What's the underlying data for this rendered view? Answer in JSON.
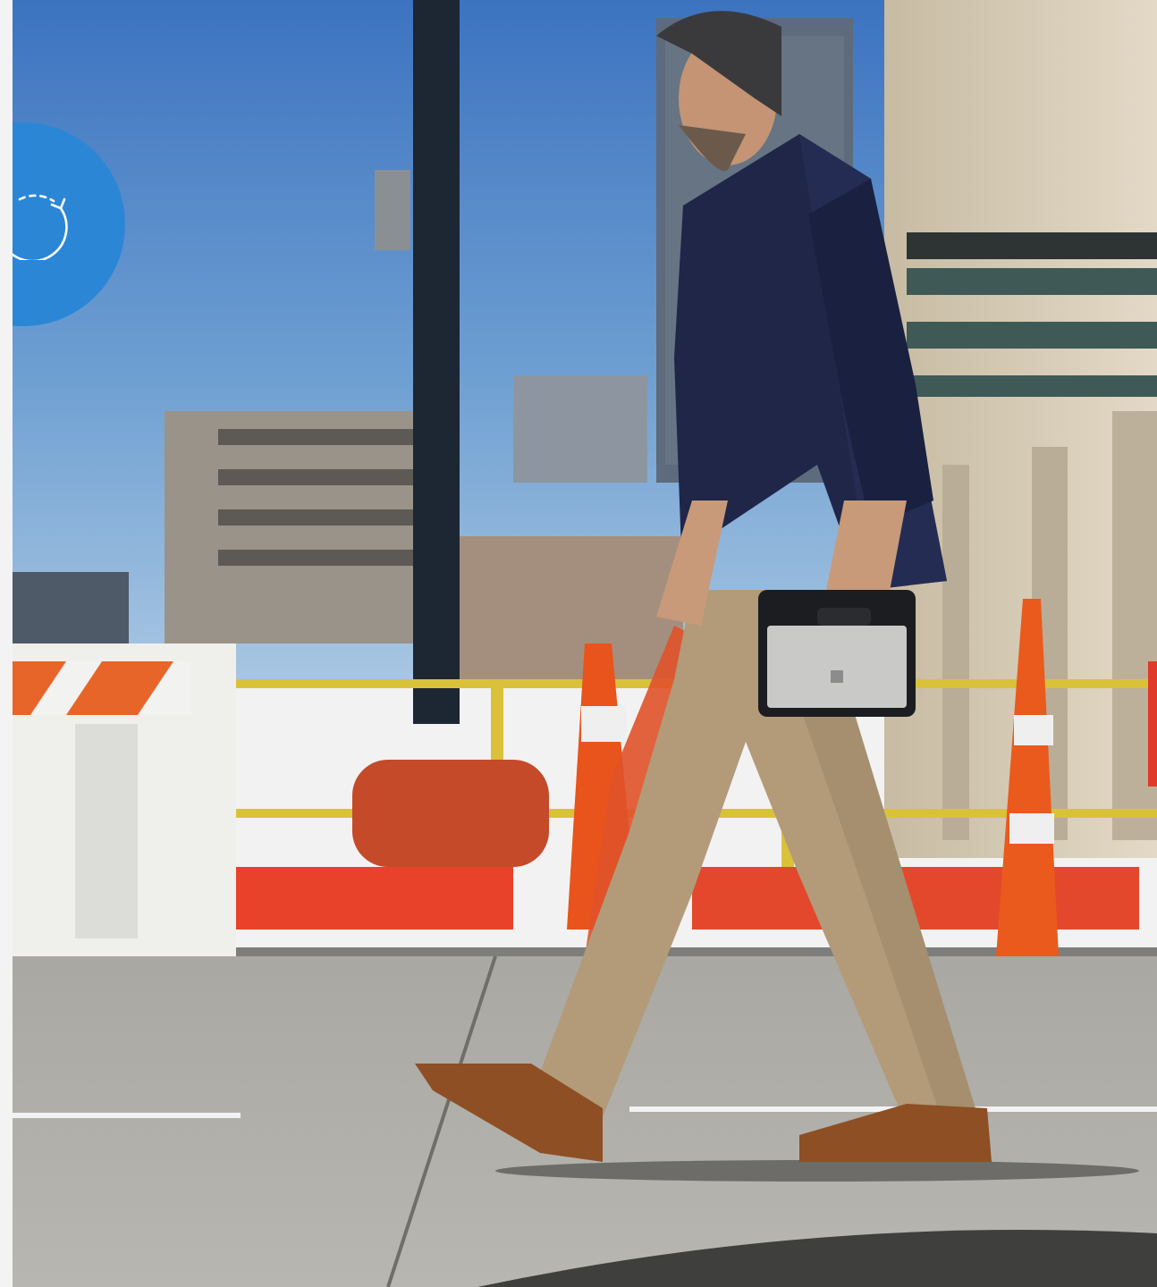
{
  "hero": {
    "scene": "man-walking-with-tablet-construction-street"
  },
  "badge": {
    "icon": "refresh-icon",
    "color": "#2b86d6"
  },
  "colors": {
    "sky_top": "#3f78c2",
    "sky_bottom": "#8cb6dc",
    "road": "#8e8e8c",
    "sidewalk": "#a7a6a2",
    "jacket": "#1f2547",
    "pants": "#b59d7b",
    "boots": "#8d4f23",
    "cone_orange": "#e8541b",
    "barrier_white": "#f1f1ef"
  }
}
